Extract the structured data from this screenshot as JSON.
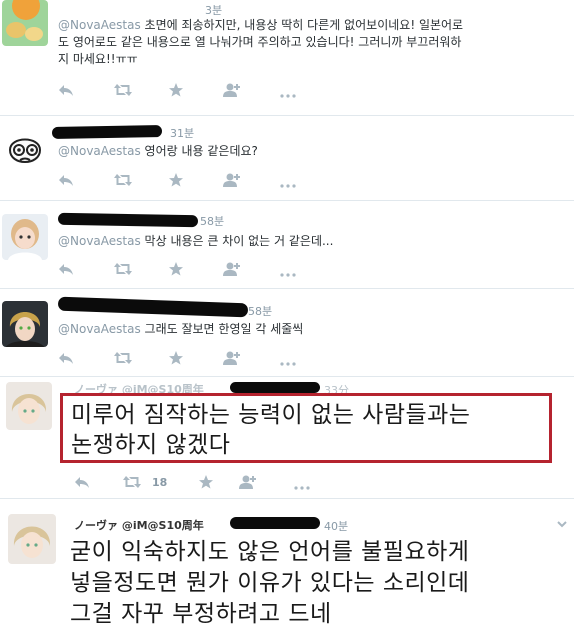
{
  "tweets": [
    {
      "time": "3분",
      "mention": "@NovaAestas",
      "text_line1": "초면에 죄송하지만, 내용상 딱히 다른게 없어보이네요! 일본어로",
      "text_line2": "도 영어로도 같은 내용으로 열 나눠가며 주의하고 있습니다! 그러니까 부끄러워하",
      "text_line3": "지 마세요!!ㅠㅠ"
    },
    {
      "time": "31분",
      "mention": "@NovaAestas",
      "text": "영어랑 내용 같은데요?"
    },
    {
      "time": "58분",
      "mention": "@NovaAestas",
      "text": "막상 내용은 큰 차이 없는 거 같은데..."
    },
    {
      "time": "58분",
      "mention": "@NovaAestas",
      "text": "그래도 잘보면 한영일 각 세줄씩"
    }
  ],
  "quote_tweet": {
    "name": "ノーヴァ @iM@S10周年",
    "time": "33分",
    "line1": "미루어 짐작하는 능력이 없는 사람들과는",
    "line2": "논쟁하지 않겠다",
    "retweet_count": "18"
  },
  "last_tweet": {
    "name": "ノーヴァ @iM@S10周年",
    "time": "40분",
    "line1": "굳이 익숙하지도 않은 언어를 불필요하게",
    "line2": "넣을정도면 뭔가 이유가 있다는 소리인데",
    "line3": "그걸 자꾸 부정하려고 드네"
  },
  "colors": {
    "accent_red": "#b5232f",
    "muted": "#8899a6",
    "icon": "#aab8c2"
  },
  "icons": [
    "reply-icon",
    "retweet-icon",
    "favorite-icon",
    "follow-icon",
    "more-icon"
  ]
}
